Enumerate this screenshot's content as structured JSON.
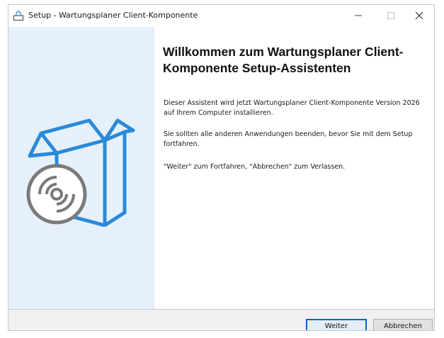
{
  "window": {
    "title": "Setup - Wartungsplaner Client-Komponente",
    "controls": {
      "minimize": "–",
      "maximize": "☐",
      "close": "✕"
    }
  },
  "main": {
    "heading": "Willkommen zum Wartungsplaner Client-Komponente Setup-Assistenten",
    "paragraph1": "Dieser Assistent wird jetzt Wartungsplaner Client-Komponente Version 2026 auf Ihrem Computer installieren.",
    "paragraph2": "Sie sollten alle anderen Anwendungen beenden, bevor Sie mit dem Setup fortfahren.",
    "paragraph3": "\"Weiter\" zum Fortfahren, \"Abbrechen\" zum Verlassen."
  },
  "footer": {
    "next_label": "Weiter",
    "cancel_label": "Abbrechen"
  },
  "colors": {
    "side_panel": "#e6f0fa",
    "accent": "#0a64c8",
    "art_blue": "#2a8ad8",
    "art_gray": "#7a7a7a"
  },
  "icons": {
    "title": "setup-app-icon",
    "side": "box-with-disc-icon"
  }
}
